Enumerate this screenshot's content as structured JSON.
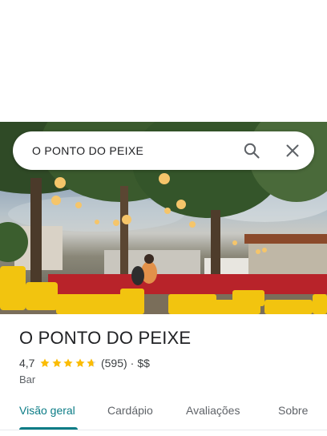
{
  "search": {
    "query": "O PONTO DO PEIXE"
  },
  "place": {
    "name": "O PONTO DO PEIXE",
    "rating": "4,7",
    "rating_value": 4.7,
    "review_count": "(595)",
    "separator": "·",
    "price": "$$",
    "category": "Bar"
  },
  "tabs": [
    {
      "label": "Visão geral",
      "active": true
    },
    {
      "label": "Cardápio",
      "active": false
    },
    {
      "label": "Avaliações",
      "active": false
    },
    {
      "label": "Sobre",
      "active": false
    }
  ],
  "colors": {
    "accent": "#0b7c86",
    "star": "#fbbc04"
  },
  "icons": [
    "search-icon",
    "close-icon",
    "star-icon"
  ]
}
